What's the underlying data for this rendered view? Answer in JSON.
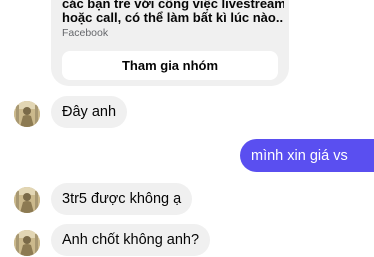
{
  "shared_post": {
    "title_line_1": "các bạn trẻ với công việc livestream",
    "title_line_2": "hoặc call, có thể làm bất kì lúc nào...",
    "source": "Facebook",
    "button_label": "Tham gia nhóm"
  },
  "messages": [
    {
      "direction": "incoming",
      "text": "Đây anh"
    },
    {
      "direction": "outgoing",
      "text": "mình xin giá vs"
    },
    {
      "direction": "incoming",
      "text": "3tr5 được không ạ"
    },
    {
      "direction": "incoming",
      "text": "Anh chốt không anh?"
    }
  ],
  "colors": {
    "outgoing_bubble": "#5a4ff0",
    "incoming_bubble": "#f0f0f0",
    "background": "#ffffff"
  }
}
